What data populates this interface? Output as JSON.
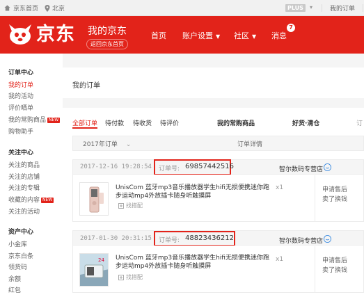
{
  "topbar": {
    "home": "京东首页",
    "location": "北京",
    "plus": "PLUS",
    "my_order": "我的订单"
  },
  "header": {
    "brand": "京东",
    "my_jd": "我的京东",
    "back_home": "返回京东首页",
    "nav": [
      {
        "label": "首页"
      },
      {
        "label": "账户设置"
      },
      {
        "label": "社区"
      },
      {
        "label": "消息"
      }
    ],
    "message_count": "7"
  },
  "sidebar": {
    "sections": [
      {
        "title": "订单中心",
        "items": [
          {
            "label": "我的订单"
          },
          {
            "label": "我的活动"
          },
          {
            "label": "评价晒单"
          },
          {
            "label": "我的常购商品",
            "badge": "NEW"
          },
          {
            "label": "购物助手"
          }
        ]
      },
      {
        "title": "关注中心",
        "items": [
          {
            "label": "关注的商品"
          },
          {
            "label": "关注的店铺"
          },
          {
            "label": "关注的专辑"
          },
          {
            "label": "收藏的内容",
            "badge": "NEW"
          },
          {
            "label": "关注的活动"
          }
        ]
      },
      {
        "title": "资产中心",
        "items": [
          {
            "label": "小金库"
          },
          {
            "label": "京东白条"
          },
          {
            "label": "领货码"
          },
          {
            "label": "余额"
          },
          {
            "label": "红包"
          }
        ]
      }
    ]
  },
  "main": {
    "title": "我的订单",
    "tabs": [
      {
        "label": "全部订单"
      },
      {
        "label": "待付款"
      },
      {
        "label": "待收货"
      },
      {
        "label": "待评价"
      },
      {
        "label": "我的常购商品"
      },
      {
        "label": "好货·清仓"
      },
      {
        "label": "订"
      }
    ],
    "table_head": {
      "period": "2017年订单",
      "details": "订单详情"
    },
    "orders": [
      {
        "date": "2017-12-16 19:28:54",
        "order_label": "订单号:",
        "order_number": "69857442516",
        "shop": "智尔数码专营店",
        "product": "UnisCom 蓝牙mp3音乐播放器学生hifi无损便携迷你跑步运动mp4外放插卡随身听触摸屏",
        "find_match": "找搭配",
        "qty": "x1",
        "actions": [
          "申请售后",
          "卖了换钱"
        ]
      },
      {
        "date": "2017-01-30 20:31:15",
        "order_label": "订单号:",
        "order_number": "48823436212",
        "shop": "智尔数码专营店",
        "product": "UnisCom 蓝牙mp3音乐播放器学生hifi无损便携迷你跑步运动mp4外放插卡随身听触摸屏",
        "find_match": "找搭配",
        "qty": "x1",
        "actions": [
          "申请售后",
          "卖了换钱"
        ]
      }
    ]
  },
  "colors": {
    "brand_red": "#e2231a",
    "badge_red": "#e2231a"
  }
}
